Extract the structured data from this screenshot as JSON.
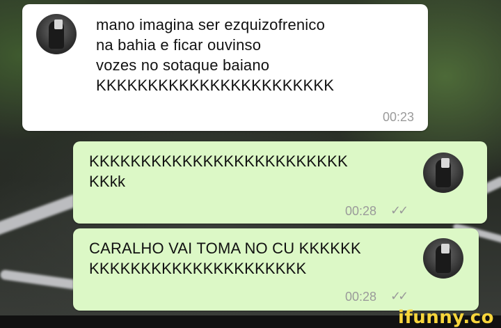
{
  "messages": [
    {
      "direction": "incoming",
      "lines": [
        "mano imagina ser ezquizofrenico",
        "na bahia e ficar ouvinso",
        "vozes no sotaque baiano",
        "KKKKKKKKKKKKKKKKKKKKKKK"
      ],
      "time": "00:23"
    },
    {
      "direction": "outgoing",
      "lines": [
        "KKKKKKKKKKKKKKKKKKKKKKKKK",
        "KKkk"
      ],
      "time": "00:28",
      "status": "read"
    },
    {
      "direction": "outgoing",
      "lines": [
        "CARALHO VAI TOMA NO CU KKKKKK",
        "KKKKKKKKKKKKKKKKKKKKK"
      ],
      "time": "00:28",
      "status": "read"
    }
  ],
  "status_icon": "double-check-icon",
  "watermark": "ifunny.co"
}
